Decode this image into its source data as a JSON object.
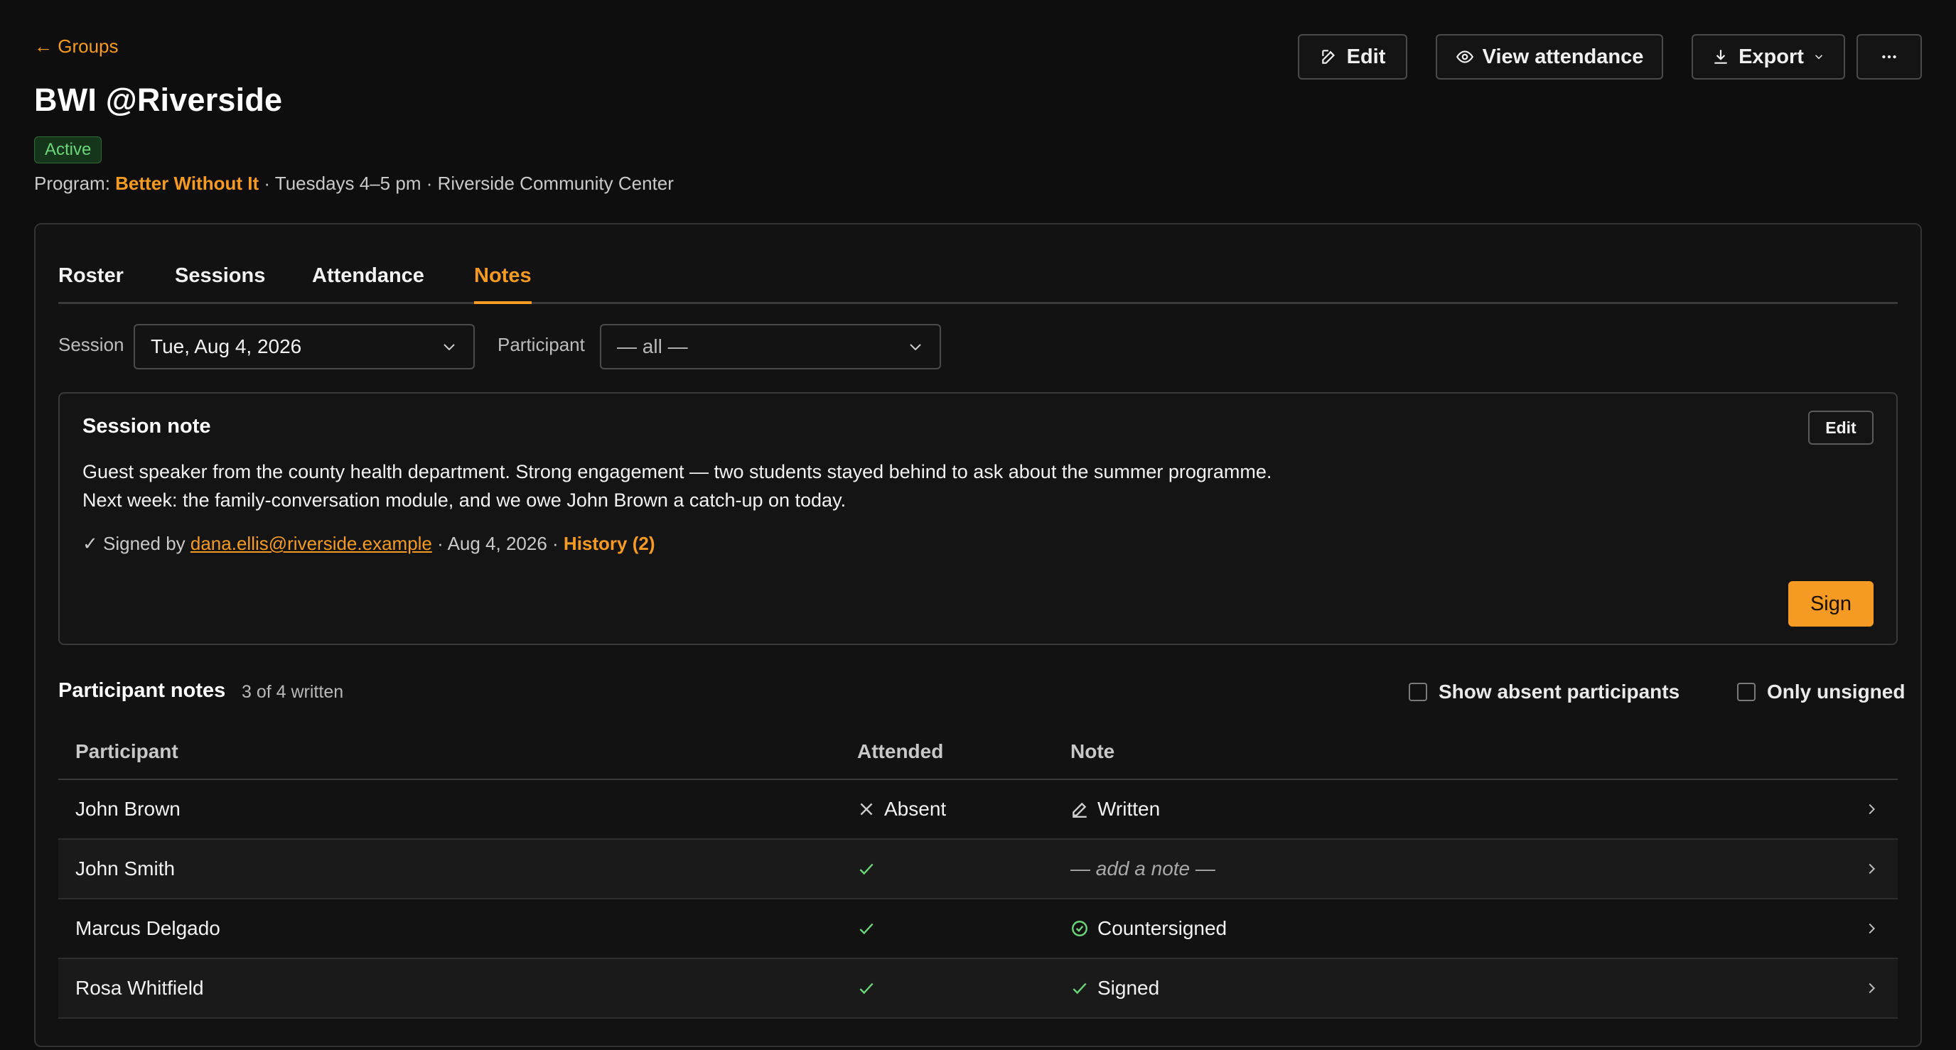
{
  "header": {
    "back_label": "← Groups",
    "title": "BWI @Riverside",
    "status": "Active",
    "meta_prefix": "Program:",
    "program": "Better Without It",
    "meta_rest": "· Tuesdays 4–5 pm · Riverside Community Center",
    "buttons": {
      "edit": "Edit",
      "view_attendance": "View attendance",
      "export": "Export"
    }
  },
  "tabs": [
    "Roster",
    "Sessions",
    "Attendance",
    "Notes"
  ],
  "active_tab": "Notes",
  "filters": {
    "session_label": "Session",
    "session_value": "Tue, Aug 4, 2026",
    "participant_label": "Participant",
    "participant_value": "— all —"
  },
  "session_note": {
    "title": "Session note",
    "edit_label": "Edit",
    "line1": "Guest speaker from the county health department. Strong engagement — two students stayed behind to ask about the summer programme.",
    "line2": "Next week: the family-conversation module, and we owe John Brown a catch-up on today.",
    "signed_prefix": "✓ Signed by",
    "signed_email": "dana.ellis@riverside.example",
    "signed_date": "· Aug 4, 2026 ·",
    "history": "History (2)",
    "sign_label": "Sign"
  },
  "participant_notes": {
    "title": "Participant notes",
    "count": "3 of 4 written",
    "show_absent_label": "Show absent participants",
    "only_unsigned_label": "Only unsigned",
    "columns": [
      "Participant",
      "Attended",
      "Note"
    ],
    "rows": [
      {
        "name": "John Brown",
        "attended": "Absent",
        "note": "Written"
      },
      {
        "name": "John Smith",
        "attended": "",
        "note": "— add a note —"
      },
      {
        "name": "Marcus Delgado",
        "attended": "",
        "note": "Countersigned"
      },
      {
        "name": "Rosa Whitfield",
        "attended": "",
        "note": "Signed"
      }
    ]
  },
  "colors": {
    "accent": "#f59a23",
    "success": "#6cd67a",
    "background": "#0e0e0e"
  }
}
